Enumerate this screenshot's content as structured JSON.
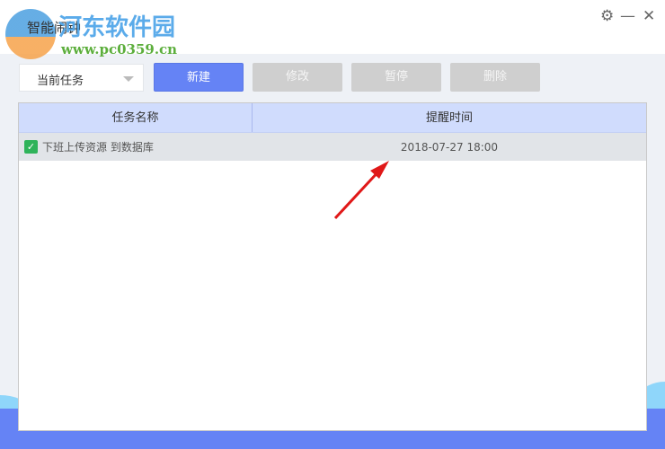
{
  "window": {
    "title": "智能闹钟",
    "watermark": "河东软件园",
    "watermark_url": "www.pc0359.cn"
  },
  "controls": {
    "settings": "⚙",
    "minimize": "—",
    "close": "✕"
  },
  "toolbar": {
    "filter": "当前任务",
    "new": "新建",
    "edit": "修改",
    "pause": "暂停",
    "delete": "删除"
  },
  "table": {
    "headers": [
      "任务名称",
      "提醒时间"
    ],
    "rows": [
      {
        "checked": true,
        "name": "下班上传资源 到数据库",
        "time": "2018-07-27 18:00"
      }
    ]
  }
}
